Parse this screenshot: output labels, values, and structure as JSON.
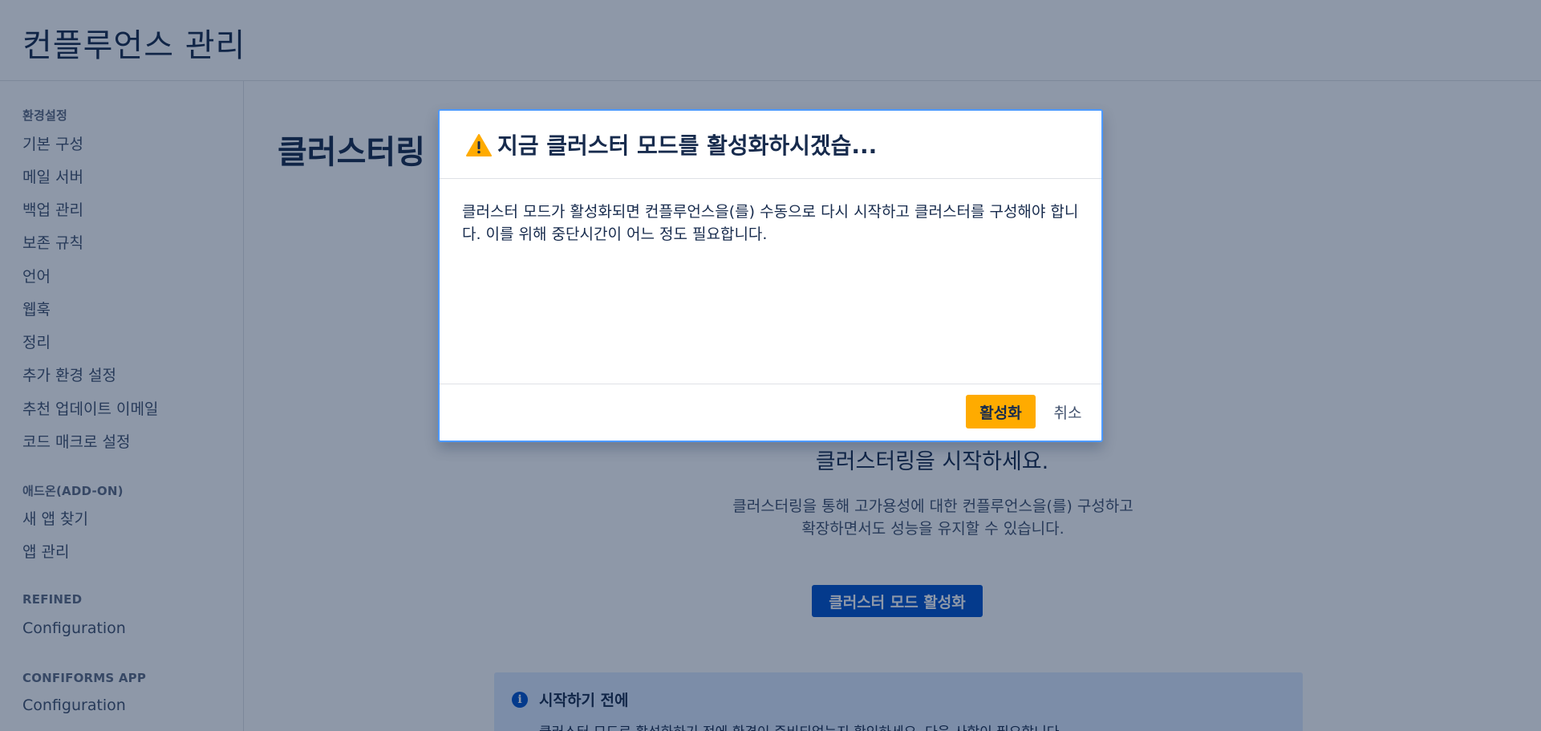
{
  "app": {
    "title": "컨플루언스 관리"
  },
  "sidebar": {
    "sections": [
      {
        "title": "환경설정",
        "items": [
          "기본 구성",
          "메일 서버",
          "백업 관리",
          "보존 규칙",
          "언어",
          "웹훅",
          "정리",
          "추가 환경 설정",
          "추천 업데이트 이메일",
          "코드 매크로 설정"
        ]
      },
      {
        "title": "애드온(ADD-ON)",
        "items": [
          "새 앱 찾기",
          "앱 관리"
        ]
      },
      {
        "title": "REFINED",
        "items": [
          "Configuration"
        ]
      },
      {
        "title": "CONFIFORMS APP",
        "items": [
          "Configuration"
        ]
      }
    ]
  },
  "main": {
    "page_title": "클러스터링",
    "empty_heading": "클러스터링을 시작하세요.",
    "empty_description": "클러스터링을 통해 고가용성에 대한 컨플루언스을(를) 구성하고 확장하면서도 성능을 유지할 수 있습니다.",
    "enable_button": "클러스터 모드 활성화",
    "info_panel": {
      "title": "시작하기 전에",
      "text": "클러스터 모드로 활성화하기 전에 환경이 준비되었는지 확인하세요. 다음 사항이 필요합니다."
    }
  },
  "modal": {
    "title": "지금 클러스터 모드를 활성화하시겠습...",
    "body": "클러스터 모드가 활성화되면 컨플루언스을(를) 수동으로 다시 시작하고 클러스터를 구성해야 합니다. 이를 위해 중단시간이 어느 정도 필요합니다.",
    "confirm_label": "활성화",
    "cancel_label": "취소"
  },
  "colors": {
    "primary": "#0052cc",
    "warning": "#ffab00",
    "overlay": "rgba(9,30,66,0.46)",
    "modal_border": "#4c9aff"
  }
}
